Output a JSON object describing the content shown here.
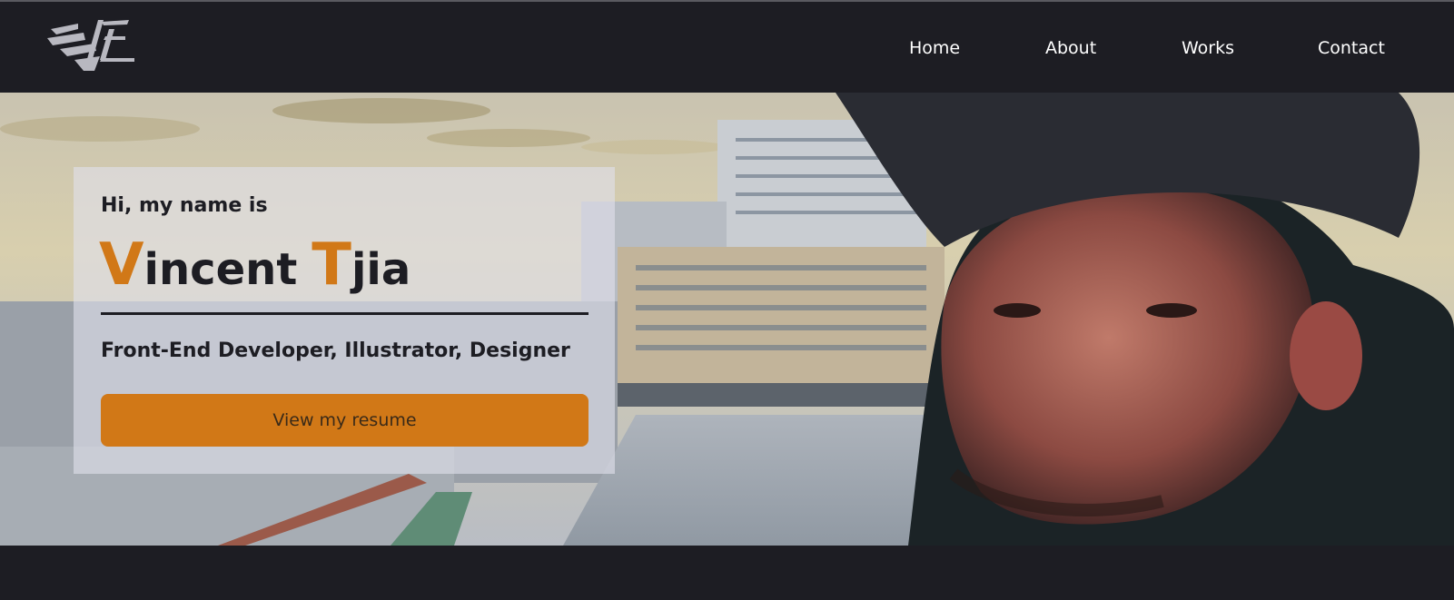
{
  "nav": {
    "logo_icon": "vt-logo-icon",
    "items": [
      "Home",
      "About",
      "Works",
      "Contact"
    ]
  },
  "hero": {
    "background": "portrait-photo-city-rooftop",
    "greeting": "Hi, my name is",
    "name": {
      "first_initial": "V",
      "first_rest": "incent",
      "last_initial": "T",
      "last_rest": "jia"
    },
    "roles": "Front-End Developer, Illustrator, Designer",
    "resume_button": "View my resume"
  },
  "colors": {
    "background": "#1d1d23",
    "accent": "#d17817",
    "nav_text": "#ffffff",
    "card_text": "#1d1d23"
  }
}
